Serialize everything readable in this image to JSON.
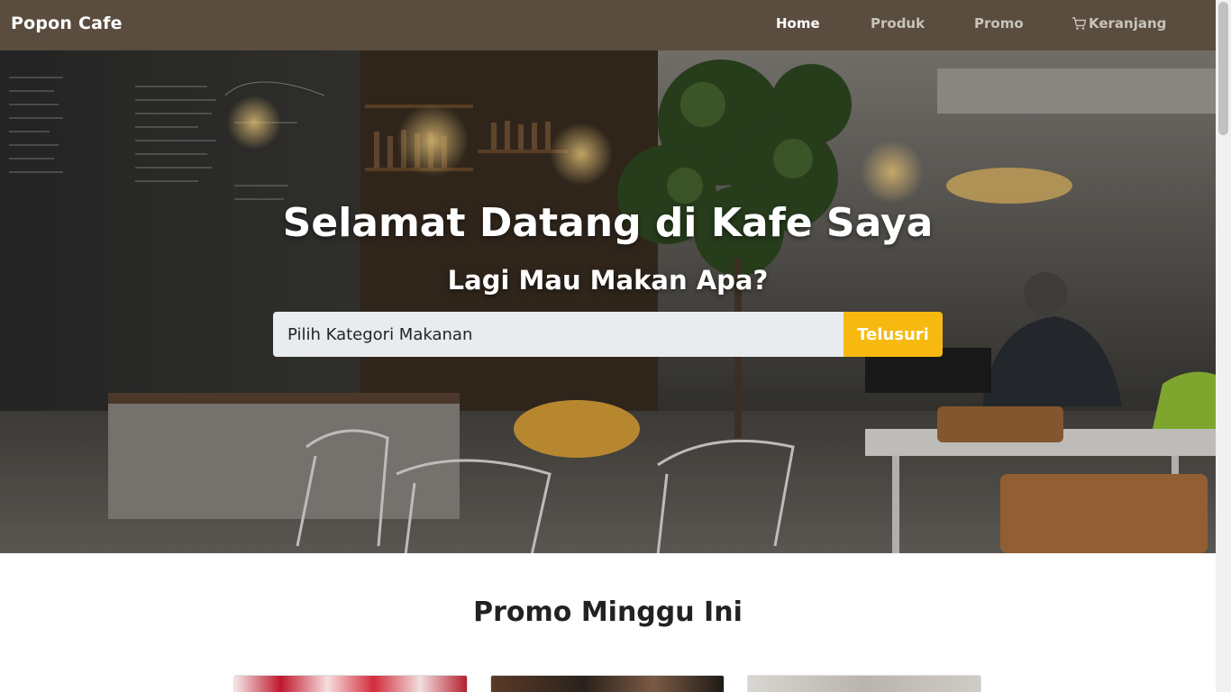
{
  "navbar": {
    "brand": "Popon Cafe",
    "items": [
      {
        "label": "Home",
        "active": true
      },
      {
        "label": "Produk",
        "active": false
      },
      {
        "label": "Promo",
        "active": false
      },
      {
        "label": "Keranjang",
        "active": false,
        "icon": "cart-icon"
      }
    ],
    "colors": {
      "background": "#5a4c3f",
      "active": "#ffffff",
      "inactive": "#c9c3bb"
    }
  },
  "hero": {
    "title": "Selamat Datang di Kafe Saya",
    "subtitle": "Lagi Mau Makan Apa?",
    "search": {
      "placeholder": "Pilih Kategori Makanan",
      "button_label": "Telusuri"
    },
    "colors": {
      "button": "#f7b90f",
      "input_bg": "#e9ecef"
    }
  },
  "promo": {
    "title": "Promo Minggu Ini"
  }
}
